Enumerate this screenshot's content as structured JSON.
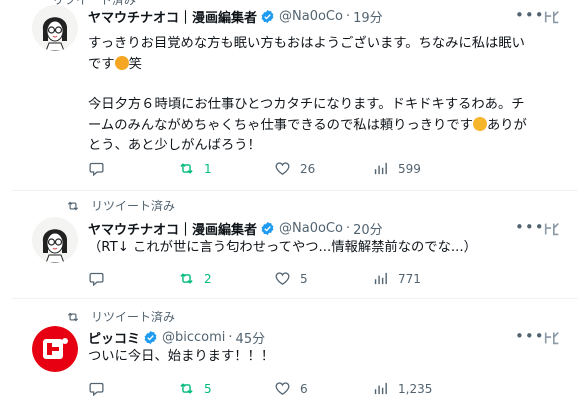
{
  "tweets": [
    {
      "retweet_label": "リツイート済み",
      "name": "ヤマウチナオコ｜漫画編集者",
      "handle": "@Na0oCo",
      "separator": "·",
      "time": "19分",
      "text_line1": "すっきりお目覚めな方も眠い方もおはようございます。ちなみに私は眠い",
      "text_line2a": "です",
      "text_line2b": "笑",
      "text_line3": "今日夕方６時頃にお仕事ひとつカタチになります。ドキドキするわあ。チ",
      "text_line4a": "ームのみんながめちゃくちゃ仕事できるので私は頼りっきりです",
      "text_line4b": "ありが",
      "text_line5": "とう、あと少しがんばろう！",
      "retweets": "1",
      "likes": "26",
      "views": "599"
    },
    {
      "retweet_label": "リツイート済み",
      "name": "ヤマウチナオコ｜漫画編集者",
      "handle": "@Na0oCo",
      "separator": "·",
      "time": "20分",
      "text_line1": "（RT↓ これが世に言う匂わせってやつ...情報解禁前なのでな...）",
      "retweets": "2",
      "likes": "5",
      "views": "771"
    },
    {
      "retweet_label": "リツイート済み",
      "name": "ピッコミ",
      "handle": "@biccomi",
      "separator": "·",
      "time": "45分",
      "text_line1": "ついに今日、始まります！！！",
      "retweets": "5",
      "likes": "6",
      "views": "1,235"
    }
  ],
  "icons": [
    "retweet-icon",
    "verified-badge-icon",
    "more-icon",
    "grok-icon",
    "reply-icon",
    "heart-icon",
    "views-icon",
    "sleepy-face-emoji",
    "heart-hands-emoji"
  ],
  "colors": {
    "retweet_green": "#00ba7c",
    "verified_blue": "#1d9bf0",
    "muted": "#536471",
    "brand_red": "#e60012"
  }
}
